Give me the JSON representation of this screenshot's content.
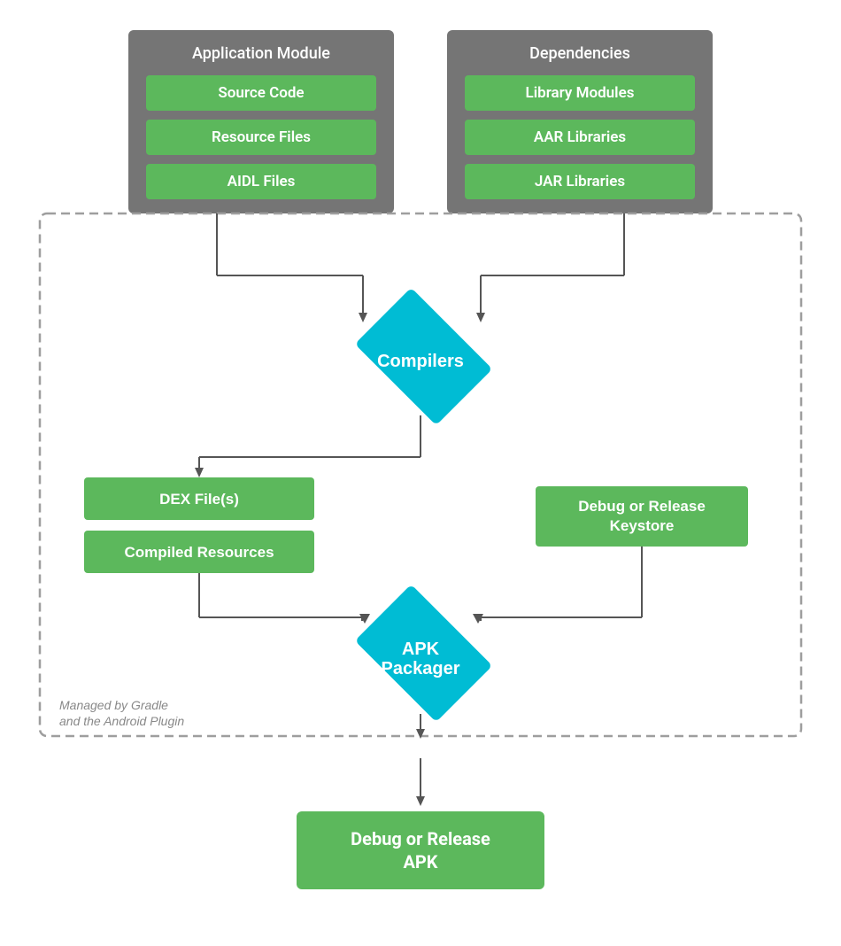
{
  "app_module": {
    "title": "Application Module",
    "items": [
      "Source Code",
      "Resource Files",
      "AIDL Files"
    ]
  },
  "dependencies": {
    "title": "Dependencies",
    "items": [
      "Library Modules",
      "AAR Libraries",
      "JAR Libraries"
    ]
  },
  "compilers": {
    "label": "Compilers"
  },
  "dex_files": {
    "label": "DEX File(s)"
  },
  "compiled_resources": {
    "label": "Compiled Resources"
  },
  "debug_release_keystore": {
    "label": "Debug or Release\nKeystore"
  },
  "apk_packager": {
    "label": "APK\nPackager"
  },
  "final_apk": {
    "label": "Debug or Release\nAPK"
  },
  "gradle_label": {
    "line1": "Managed by Gradle",
    "line2": "and the Android Plugin"
  },
  "colors": {
    "green": "#5cb85c",
    "cyan": "#00bcd4",
    "gray": "#757575",
    "white": "#ffffff",
    "dashed": "#9e9e9e"
  }
}
